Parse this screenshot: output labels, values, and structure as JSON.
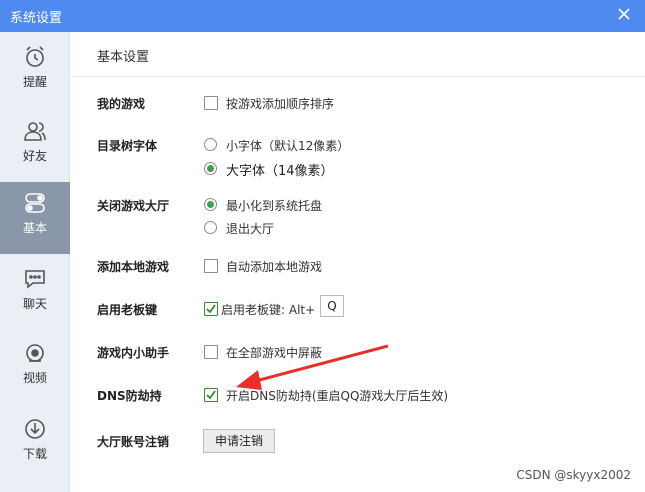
{
  "window": {
    "title": "系统设置"
  },
  "sidebar": {
    "items": [
      {
        "label": "提醒",
        "active": false
      },
      {
        "label": "好友",
        "active": false
      },
      {
        "label": "基本",
        "active": true
      },
      {
        "label": "聊天",
        "active": false
      },
      {
        "label": "视频",
        "active": false
      },
      {
        "label": "下载",
        "active": false
      }
    ]
  },
  "main": {
    "title": "基本设置",
    "my_games": {
      "label": "我的游戏",
      "option": "按游戏添加顺序排序",
      "checked": false
    },
    "tree_font": {
      "label": "目录树字体",
      "options": [
        "小字体（默认12像素）",
        "大字体（14像素）"
      ],
      "selected": 1
    },
    "close_lobby": {
      "label": "关闭游戏大厅",
      "options": [
        "最小化到系统托盘",
        "退出大厅"
      ],
      "selected": 0
    },
    "add_local": {
      "label": "添加本地游戏",
      "option": "自动添加本地游戏",
      "checked": false
    },
    "boss_key": {
      "label": "启用老板键",
      "option": "启用老板键: Alt+",
      "key": "Q",
      "checked": true
    },
    "assistant": {
      "label": "游戏内小助手",
      "option": "在全部游戏中屏蔽",
      "checked": false
    },
    "dns": {
      "label": "DNS防劫持",
      "option": "开启DNS防劫持(重启QQ游戏大厅后生效)",
      "checked": true
    },
    "account": {
      "label": "大厅账号注销",
      "button": "申请注销"
    }
  },
  "annotation": {
    "color": "#e8302a"
  },
  "watermark": "CSDN @skyyx2002"
}
